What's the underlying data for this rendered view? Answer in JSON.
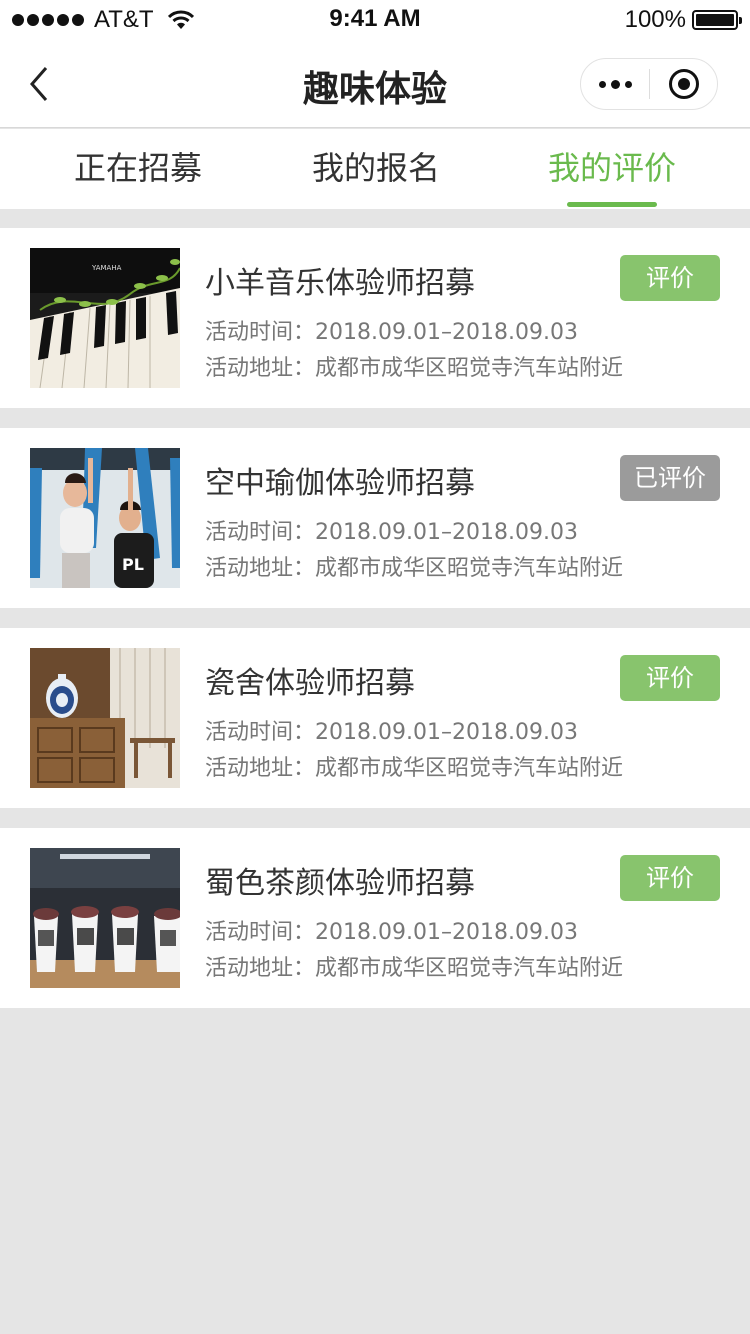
{
  "status_bar": {
    "carrier": "AT&T",
    "time": "9:41 AM",
    "battery": "100%"
  },
  "nav": {
    "title": "趣味体验"
  },
  "tabs": [
    {
      "label": "正在招募",
      "active": false
    },
    {
      "label": "我的报名",
      "active": false
    },
    {
      "label": "我的评价",
      "active": true
    }
  ],
  "colors": {
    "accent": "#6aba4d",
    "button_green": "#88c46d",
    "button_gray": "#9b9b9b",
    "background": "#e5e5e5"
  },
  "labels": {
    "time": "活动时间：",
    "address": "活动地址："
  },
  "items": [
    {
      "title": "小羊音乐体验师招募",
      "time": "2018.09.01–2018.09.03",
      "address": "成都市成华区昭觉寺汽车站附近",
      "button": "评价",
      "image": "piano-image"
    },
    {
      "title": "空中瑜伽体验师招募",
      "time": "2018.09.01–2018.09.03",
      "address": "成都市成华区昭觉寺汽车站附近",
      "button": "已评价",
      "image": "aerial-yoga-image"
    },
    {
      "title": "瓷舍体验师招募",
      "time": "2018.09.01–2018.09.03",
      "address": "成都市成华区昭觉寺汽车站附近",
      "button": "评价",
      "image": "porcelain-shop-image"
    },
    {
      "title": "蜀色茶颜体验师招募",
      "time": "2018.09.01–2018.09.03",
      "address": "成都市成华区昭觉寺汽车站附近",
      "button": "评价",
      "image": "tea-cups-image"
    }
  ]
}
